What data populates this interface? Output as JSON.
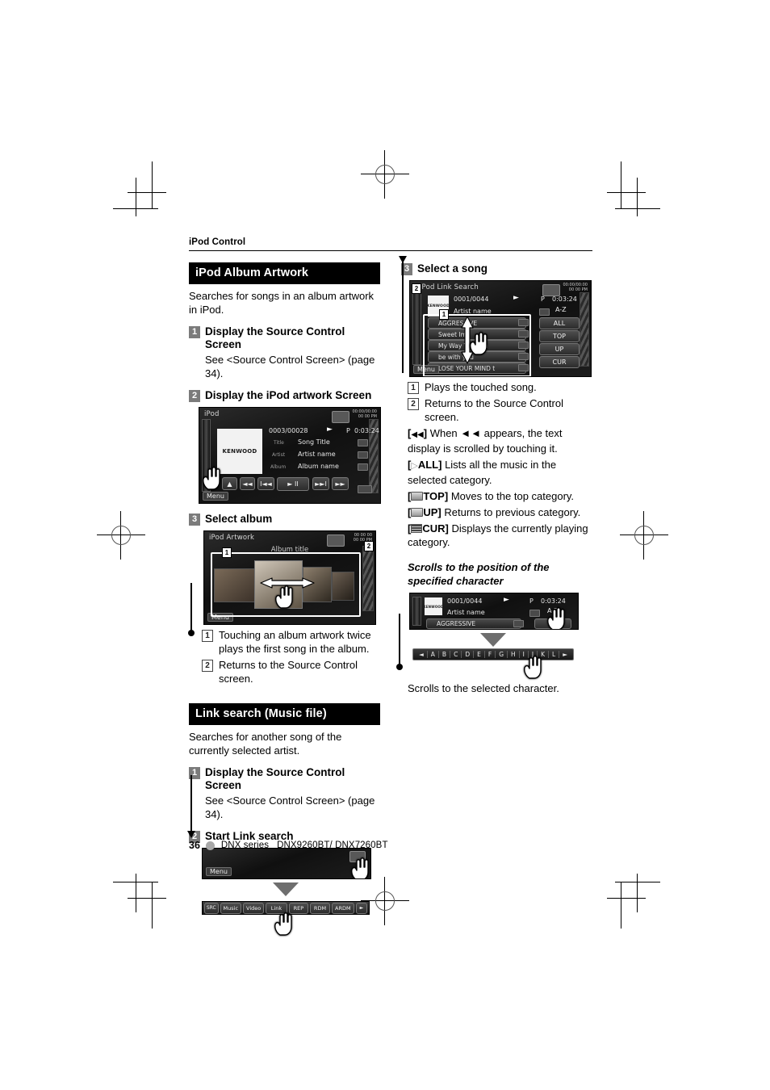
{
  "running_head": "iPod Control",
  "footer": {
    "page_number": "36",
    "series": "DNX series",
    "models": "DNX9260BT/ DNX7260BT"
  },
  "left_column": {
    "section1": {
      "banner": "iPod Album Artwork",
      "intro": "Searches for songs in an album artwork in iPod.",
      "step1": {
        "num": "1",
        "title": "Display the Source Control Screen",
        "sub": "See <Source Control Screen> (page 34)."
      },
      "step2": {
        "num": "2",
        "title": "Display the iPod artwork Screen"
      },
      "step3": {
        "num": "3",
        "title": "Select album"
      },
      "notes": [
        {
          "num": "1",
          "text": "Touching an album artwork twice plays the first song in the album."
        },
        {
          "num": "2",
          "text": "Returns to the Source Control screen."
        }
      ]
    },
    "section2": {
      "banner": "Link search (Music file)",
      "intro": "Searches for another song of the currently selected artist.",
      "step1": {
        "num": "1",
        "title": "Display the Source Control Screen",
        "sub": "See <Source Control Screen> (page 34)."
      },
      "step2": {
        "num": "2",
        "title": "Start Link search"
      }
    }
  },
  "right_column": {
    "step3": {
      "num": "3",
      "title": "Select a song"
    },
    "notes": [
      {
        "num": "1",
        "text": "Plays the touched song."
      },
      {
        "num": "2",
        "text": "Returns to the Source Control screen."
      }
    ],
    "keys": [
      {
        "tag_pre": "[",
        "tag_icon": "rewind-icon",
        "tag_post": "]",
        "label": "",
        "desc": "When ◄◄ appears, the text display is scrolled by touching it."
      },
      {
        "tag_pre": "[",
        "tag_icon": "play-triangle-icon",
        "tag_post": "]",
        "label": "ALL",
        "desc": "Lists all the music in the selected category."
      },
      {
        "tag_pre": "[",
        "tag_icon": "top-folder-icon",
        "tag_post": "]",
        "label": "TOP",
        "desc": "Moves to the top category."
      },
      {
        "tag_pre": "[",
        "tag_icon": "up-folder-icon",
        "tag_post": "]",
        "label": "UP",
        "desc": "Returns to previous category."
      },
      {
        "tag_pre": "[",
        "tag_icon": "list-icon",
        "tag_post": "]",
        "label": "CUR",
        "desc": "Displays the currently playing category."
      }
    ],
    "subsection": {
      "heading": "Scrolls to the position of the specified character",
      "caption": "Scrolls to the selected character."
    }
  },
  "screens": {
    "ipod_source_control": {
      "title": "iPod",
      "clock_top": "00:00/00:00",
      "clock_bottom": "00 00 PM",
      "track_counter": "0003/00028",
      "play_mode": "P",
      "elapsed": "0:03:24",
      "jacket_label": "KENWOOD",
      "rows": [
        {
          "label": "Title",
          "value": "Song Title"
        },
        {
          "label": "Artist",
          "value": "Artist name"
        },
        {
          "label": "Album",
          "value": "Album name"
        }
      ],
      "transport": [
        "▲",
        "◄◄",
        "I◄◄",
        "► II",
        "►►I",
        "►►"
      ],
      "menu_label": "Menu"
    },
    "ipod_artwork": {
      "title": "iPod Artwork",
      "album_title": "Album title",
      "clock_top": "00 00 00",
      "clock_bottom": "00 00 PM",
      "menu_label": "Menu",
      "callout_1": "1",
      "callout_2": "2"
    },
    "link_search": {
      "title": "iPod Link Search",
      "track_counter": "0001/0044",
      "play_mode": "P",
      "elapsed": "0:03:24",
      "artist": "Artist name",
      "az_button": "A-Z",
      "clock_top": "00:00/00:00",
      "clock_bottom": "00 00 PM",
      "songs": [
        "AGGRESSIVE",
        "Sweet Ima",
        "My Way You Can",
        "be with you",
        "LOSE YOUR MIND t"
      ],
      "side_buttons": [
        "ALL",
        "TOP",
        "UP",
        "CUR"
      ],
      "menu_label": "Menu",
      "callout_1": "1",
      "callout_2": "2"
    },
    "link_start": {
      "menu_label": "Menu",
      "toolbar": [
        "SRC",
        "Music",
        "Video",
        "Link",
        "REP",
        "RDM",
        "ARDM"
      ]
    },
    "az_screen": {
      "track_counter": "0001/0044",
      "play_mode": "P",
      "elapsed": "0:03:24",
      "artist": "Artist name",
      "az_button": "A-Z",
      "song": "AGGRESSIVE",
      "jacket_label": "KENWOOD"
    },
    "alphabet_bar": {
      "prev": "◄",
      "letters": [
        "A",
        "B",
        "C",
        "D",
        "E",
        "F",
        "G",
        "H",
        "I",
        "J",
        "K",
        "L"
      ],
      "next": "►"
    }
  }
}
